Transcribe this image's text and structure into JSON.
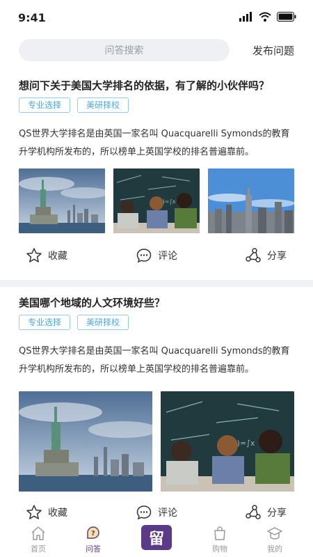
{
  "status": {
    "time": "9:41"
  },
  "search": {
    "placeholder": "问答搜索",
    "ask_label": "发布问题"
  },
  "posts": [
    {
      "title": "想问下关于美国大学排名的依据，有了解的小伙伴吗？",
      "tags": [
        "专业选择",
        "美研择校"
      ],
      "desc": "QS世界大学排名是由英国一家名叫 Quacquarelli Symonds的教育升学机构所发布的，所以榜单上英国学校的排名普遍靠前。",
      "actions": {
        "fav": "收藏",
        "comment": "评论",
        "share": "分享"
      }
    },
    {
      "title": "美国哪个地域的人文环境好些？",
      "tags": [
        "专业选择",
        "美研择校"
      ],
      "desc": "QS世界大学排名是由英国一家名叫 Quacquarelli Symonds的教育升学机构所发布的，所以榜单上英国学校的排名普遍靠前。",
      "actions": {
        "fav": "收藏",
        "comment": "评论",
        "share": "分享"
      }
    }
  ],
  "tabbar": {
    "home": "首页",
    "qa": "问答",
    "center": "留",
    "shop": "购物",
    "mine": "我的"
  },
  "colors": {
    "accent": "#5b3a8a",
    "tag": "#4da7e6"
  }
}
